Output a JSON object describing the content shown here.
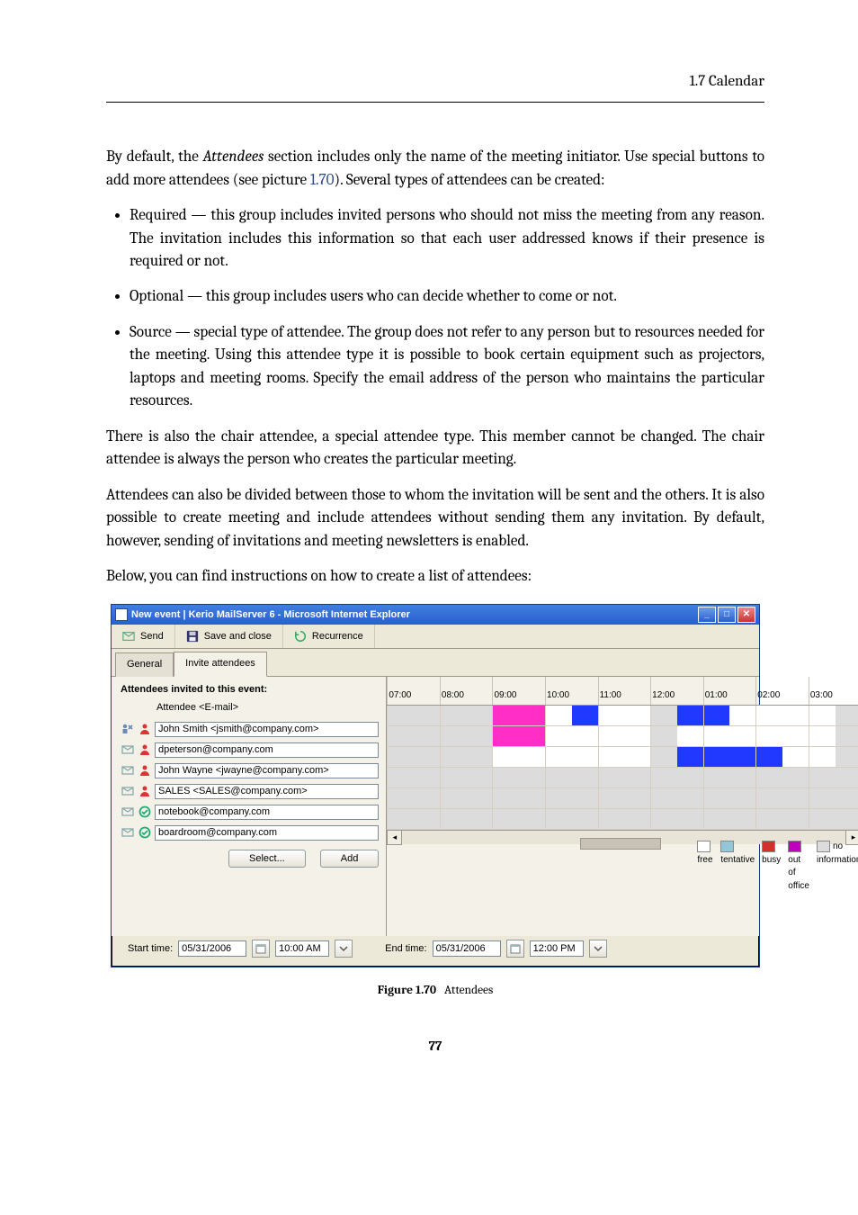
{
  "runhead": "1.7 Calendar",
  "page_number": "77",
  "intro": {
    "p1a": "By default, the ",
    "p1b": "Attendees",
    "p1c": " section includes only the name of the meeting initiator. Use special buttons to add more attendees (see picture ",
    "p1link": "1.70",
    "p1d": "). Several types of attendees can be created:"
  },
  "bullets": [
    "Required — this group includes invited persons who should not miss the meeting from any reason. The invitation includes this information so that each user addressed knows if their presence is required or not.",
    "Optional — this group includes users who can decide whether to come or not.",
    "Source — special type of attendee. The group does not refer to any person but to resources needed for the meeting. Using this attendee type it is possible to book certain equipment such as projectors, laptops and meeting rooms. Specify the email address of the person who maintains the particular resources."
  ],
  "after": {
    "p2": "There is also the chair attendee, a special attendee type. This member cannot be changed. The chair attendee is always the person who creates the particular meeting.",
    "p3": "Attendees can also be divided between those to whom the invitation will be sent and the others. It is also possible to create meeting and include attendees without sending them any invitation. By default, however, sending of invitations and meeting newsletters is enabled.",
    "p4": "Below, you can find instructions on how to create a list of attendees:"
  },
  "figure": {
    "label": "Figure 1.70",
    "caption": "Attendees"
  },
  "window": {
    "title": "New event | Kerio MailServer 6 - Microsoft Internet Explorer",
    "toolbar": {
      "send": "Send",
      "saveclose": "Save and close",
      "recurrence": "Recurrence"
    },
    "tabs": {
      "general": "General",
      "invite": "Invite attendees"
    },
    "attendees": {
      "header": "Attendees invited to this event:",
      "subheader": "Attendee <E-mail>",
      "rows": [
        {
          "kind": "chair",
          "role": "person",
          "email": "John Smith <jsmith@company.com>"
        },
        {
          "kind": "required",
          "role": "person",
          "email": "dpeterson@company.com"
        },
        {
          "kind": "required",
          "role": "person",
          "email": "John Wayne <jwayne@company.com>"
        },
        {
          "kind": "required",
          "role": "person",
          "email": "SALES <SALES@company.com>"
        },
        {
          "kind": "required",
          "role": "resource",
          "email": "notebook@company.com"
        },
        {
          "kind": "required",
          "role": "resource",
          "email": "boardroom@company.com"
        }
      ],
      "select_btn": "Select...",
      "add_btn": "Add"
    },
    "fb": {
      "hours": [
        "07:00",
        "08:00",
        "09:00",
        "10:00",
        "11:00",
        "12:00",
        "01:00",
        "02:00",
        "03:00"
      ],
      "legend": {
        "free": "free",
        "tentative": "tentative",
        "busy": "busy",
        "outofoffice": "out of office",
        "noinfo": "no information"
      }
    },
    "times": {
      "start_label": "Start time:",
      "start_date": "05/31/2006",
      "start_time": "10:00 AM",
      "end_label": "End time:",
      "end_date": "05/31/2006",
      "end_time": "12:00 PM"
    }
  }
}
